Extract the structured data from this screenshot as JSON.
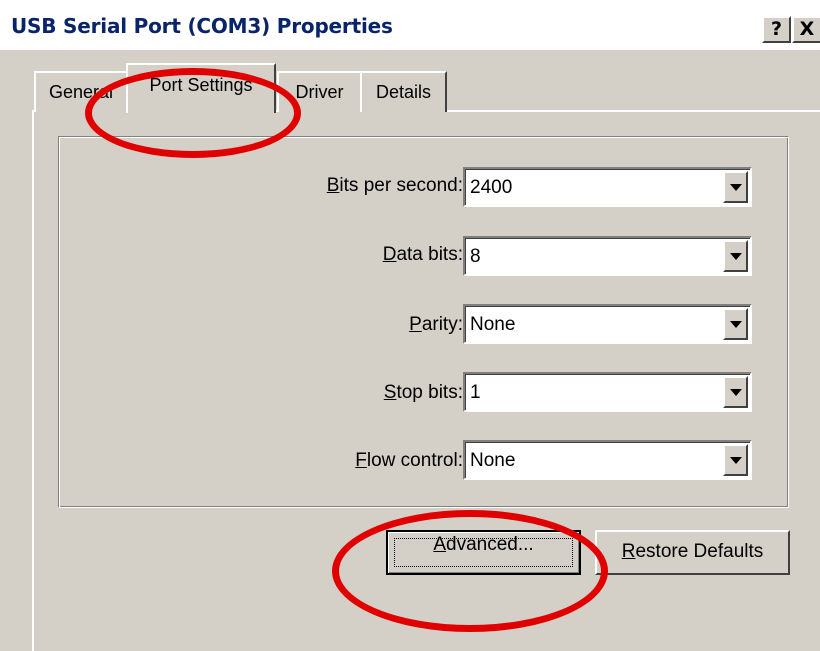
{
  "window": {
    "title": "USB Serial Port (COM3) Properties",
    "help_glyph": "?",
    "close_glyph": "X"
  },
  "tabs": [
    {
      "label": "General",
      "active": false
    },
    {
      "label": "Port Settings",
      "active": true
    },
    {
      "label": "Driver",
      "active": false
    },
    {
      "label": "Details",
      "active": false
    }
  ],
  "settings": {
    "bits_per_second": {
      "accel": "B",
      "rest": "its per second:",
      "value": "2400"
    },
    "data_bits": {
      "accel": "D",
      "rest": "ata bits:",
      "value": "8"
    },
    "parity": {
      "accel": "P",
      "rest": "arity:",
      "value": "None"
    },
    "stop_bits": {
      "accel": "S",
      "rest": "top bits:",
      "value": "1"
    },
    "flow_control": {
      "accel": "F",
      "rest": "low control:",
      "value": "None"
    }
  },
  "buttons": {
    "advanced": {
      "accel": "A",
      "rest": "dvanced..."
    },
    "restore": {
      "accel": "R",
      "rest": "estore Defaults"
    }
  },
  "annotation_color": "#e00000"
}
